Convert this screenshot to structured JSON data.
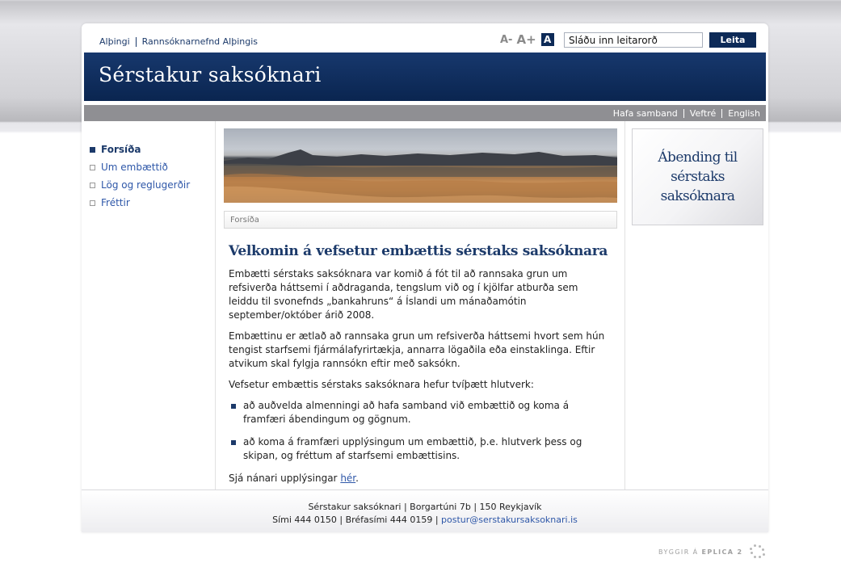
{
  "top_links": [
    "Alþingi",
    "Rannsóknarnefnd Alþingis"
  ],
  "font_size_controls": {
    "smaller": "A-",
    "larger": "A+",
    "normal": "A"
  },
  "search": {
    "value": "Sláðu inn leitarorð",
    "button_label": "Leita"
  },
  "site_title": "Sérstakur saksóknari",
  "utility_links": [
    "Hafa samband",
    "Veftré",
    "English"
  ],
  "nav": [
    {
      "label": "Forsíða",
      "active": true
    },
    {
      "label": "Um embættið",
      "active": false
    },
    {
      "label": "Lög og reglugerðir",
      "active": false
    },
    {
      "label": "Fréttir",
      "active": false
    }
  ],
  "breadcrumb": "Forsíða",
  "main": {
    "title": "Velkomin á vefsetur embættis sérstaks saksóknara",
    "paragraphs": [
      "Embætti sérstaks saksóknara var komið á fót til að rannsaka grun um refsiverða háttsemi í aðdraganda, tengslum við og í kjölfar atburða sem leiddu til svonefnds „bankahruns“ á Íslandi um mánaðamótin september/október árið 2008.",
      "Embættinu er ætlað að rannsaka grun um refsiverða háttsemi hvort sem hún tengist starfsemi fjármálafyrirtækja, annarra lögaðila eða einstaklinga. Eftir atvikum skal fylgja rannsókn eftir með saksókn.",
      "Vefsetur embættis sérstaks saksóknara hefur tvíþætt hlutverk:"
    ],
    "bullets": [
      "að auðvelda almenningi að hafa samband við embættið og koma á framfæri ábendingum og gögnum.",
      "að koma á framfæri upplýsingum um embættið, þ.e. hlutverk þess og skipan, og fréttum af starfsemi embættisins."
    ],
    "more_info_text": "Sjá nánari upplýsingar ",
    "more_info_link": "hér",
    "more_info_end": "."
  },
  "sidebar_box": {
    "text": "Ábending til sérstaks saksóknara"
  },
  "footer": {
    "line1": "Sérstakur saksóknari | Borgartúni 7b | 150 Reykjavík",
    "line2": "Sími 444 0150 | Bréfasími 444 0159 | ",
    "email": "postur@serstakursaksoknari.is"
  },
  "credit": {
    "prefix": "BYGGIR Á",
    "brand": "EPLICA 2"
  },
  "colors": {
    "brand_navy": "#0d2a57",
    "link_blue": "#2e57a8",
    "grey_bar": "#8f8f93"
  }
}
